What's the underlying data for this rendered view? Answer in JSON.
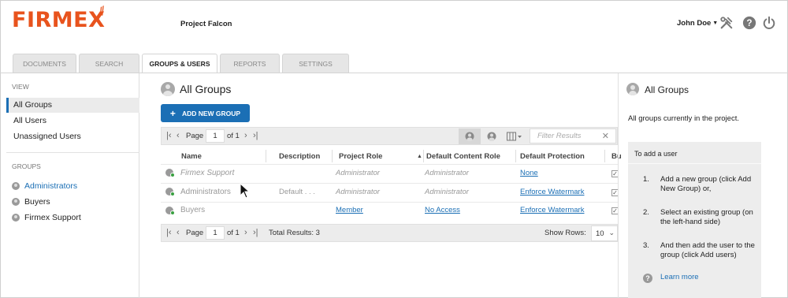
{
  "header": {
    "logo_text": "FIRMEX",
    "project_name": "Project Falcon",
    "user_name": "John Doe",
    "icons": [
      "tools-icon",
      "help-icon",
      "power-icon"
    ]
  },
  "tabs": [
    {
      "label": "DOCUMENTS",
      "active": false
    },
    {
      "label": "SEARCH",
      "active": false
    },
    {
      "label": "GROUPS & USERS",
      "active": true
    },
    {
      "label": "REPORTS",
      "active": false
    },
    {
      "label": "SETTINGS",
      "active": false
    }
  ],
  "sidebar": {
    "view_heading": "VIEW",
    "view_items": [
      {
        "label": "All Groups",
        "selected": true
      },
      {
        "label": "All Users",
        "selected": false
      },
      {
        "label": "Unassigned Users",
        "selected": false
      }
    ],
    "groups_heading": "GROUPS",
    "groups": [
      {
        "label": "Administrators",
        "active": true
      },
      {
        "label": "Buyers",
        "active": false
      },
      {
        "label": "Firmex Support",
        "active": false
      }
    ]
  },
  "main": {
    "title": "All Groups",
    "add_button": "ADD NEW GROUP",
    "pager": {
      "page_label": "Page",
      "page_value": "1",
      "of_label": "of 1",
      "filter_placeholder": "Filter Results",
      "total_results": "Total Results: 3",
      "show_rows_label": "Show Rows:",
      "show_rows_value": "10"
    },
    "columns": [
      "Name",
      "Description",
      "Project Role",
      "Default Content Role",
      "Default Protection",
      "Bu"
    ],
    "rows": [
      {
        "name": "Firmex Support",
        "description": "",
        "project_role": "Administrator",
        "content_role": "Administrator",
        "protection": "None",
        "checked": true
      },
      {
        "name": "Administrators",
        "description": "Default . . .",
        "project_role": "Administrator",
        "content_role": "Administrator",
        "protection": "Enforce Watermark",
        "checked": true
      },
      {
        "name": "Buyers",
        "description": "",
        "project_role": "Member",
        "content_role": "No Access",
        "protection": "Enforce Watermark",
        "checked": true
      }
    ]
  },
  "right_panel": {
    "title": "All Groups",
    "description": "All groups currently in the project.",
    "box_title": "To add a user",
    "steps": [
      {
        "num": "1.",
        "text": "Add a new group (click Add New Group) or,"
      },
      {
        "num": "2.",
        "text": "Select an existing group (on the left-hand side)"
      },
      {
        "num": "3.",
        "text": "And then add the user to the group (click Add users)"
      }
    ],
    "learn_more": "Learn more"
  }
}
